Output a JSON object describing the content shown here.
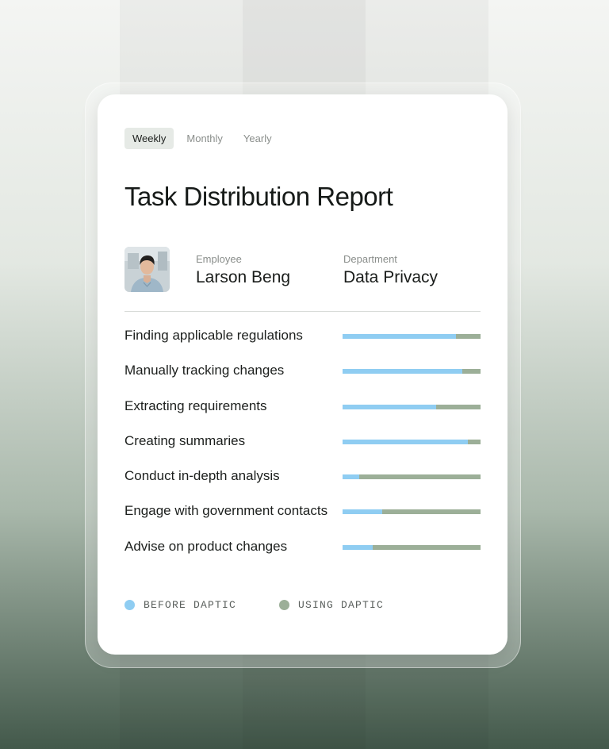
{
  "tabs": [
    {
      "label": "Weekly",
      "active": true
    },
    {
      "label": "Monthly",
      "active": false
    },
    {
      "label": "Yearly",
      "active": false
    }
  ],
  "title": "Task Distribution Report",
  "employee": {
    "label": "Employee",
    "value": "Larson Beng"
  },
  "department": {
    "label": "Department",
    "value": "Data Privacy"
  },
  "colors": {
    "before": "#8fcdf2",
    "using": "#9caf98",
    "active_tab_bg": "#e6eae6"
  },
  "chart_data": {
    "type": "bar",
    "orientation": "horizontal",
    "stacked": true,
    "normalized": true,
    "categories": [
      "Finding applicable regulations",
      "Manually tracking changes",
      "Extracting requirements",
      "Creating summaries",
      "Conduct in-depth analysis",
      "Engage with government contacts",
      "Advise on product changes"
    ],
    "series": [
      {
        "name": "BEFORE DAPTIC",
        "values": [
          0.82,
          0.87,
          0.68,
          0.91,
          0.12,
          0.29,
          0.22
        ]
      },
      {
        "name": "USING DAPTIC",
        "values": [
          0.18,
          0.13,
          0.32,
          0.09,
          0.88,
          0.71,
          0.78
        ]
      }
    ],
    "legend": "bottom-left"
  }
}
